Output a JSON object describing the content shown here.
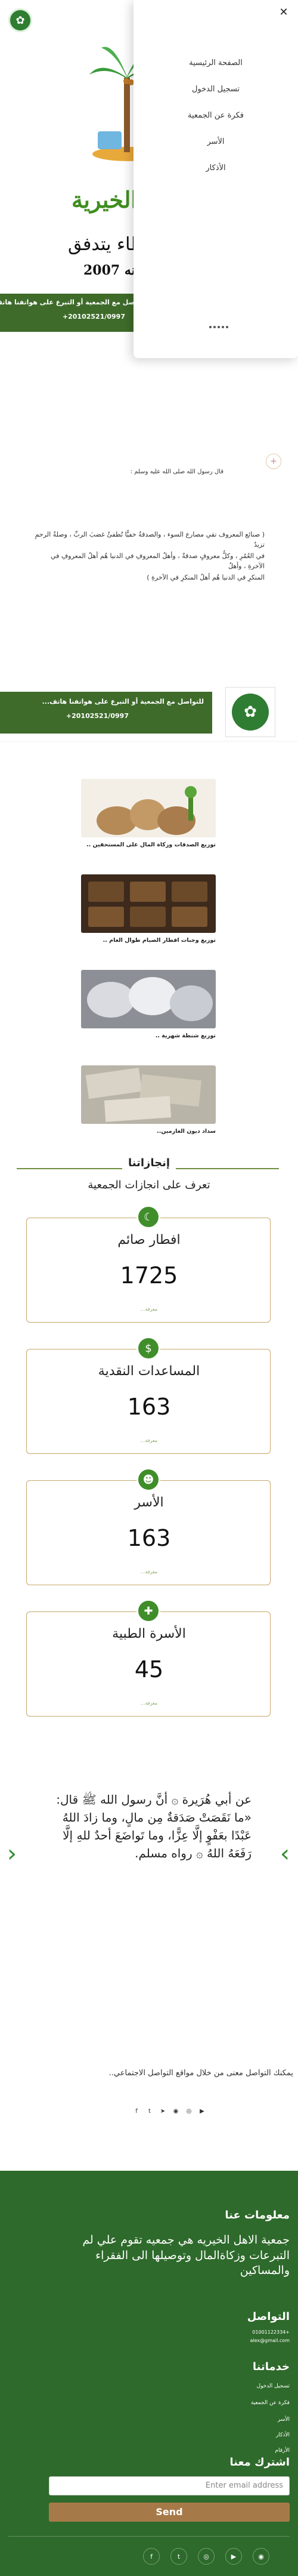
{
  "hero": {
    "name": "الخيرية",
    "line1": "عطاء يتدفق",
    "line2": "بسنه 2007",
    "bar_text": "للتواصل مع الجمعية أو التبرع على هواتفنا هاتف...",
    "bar_phone": "20102521/0997+"
  },
  "menu": {
    "items": [
      "الصفحة الرئيسية",
      "تسجيل الدخول",
      "فكرة عن الجمعية",
      "الأسر",
      "الأذكار"
    ],
    "close_icon": "close-icon"
  },
  "intro": {
    "hadith_ref": "قال رسول الله صلى الله عليه وسلم :",
    "p1": "( صنائع المعروف تقي مصارع السوء ، والصدقةُ خفيًّا تُطفئُ غضبَ الربِّ ، وصلةُ الرحمِ تزيدُ",
    "p2": "في العُمُرِ ، وكلُّ معروفٍ صدقةٌ ، وأهلُ المعروفِ في الدنيا هُم أهلُ المعروفِ في الآخرةِ ، وأهلُ",
    "p3": "المنكرِ في الدنيا هُم أهلُ المنكرِ في الآخرةِ )"
  },
  "section2": {
    "bar_text": "للتواصل مع الجمعية أو التبرع على هواتفنا هاتف...",
    "bar_phone": "20102521/0997+"
  },
  "gallery": [
    {
      "caption": "توزيع الصدقات وزكاة المال على المستحقين .."
    },
    {
      "caption": "توزيع وجبات افطار الصيام طوال العام .."
    },
    {
      "caption": "توزيع شنطة شهرية .."
    },
    {
      "caption": "سداد ديون الغارمين.."
    }
  ],
  "achievements": {
    "title": "إنجازاتنا",
    "subtitle": "تعرف على انجازات الجمعية",
    "cards": [
      {
        "label": "افطار صائم",
        "value": "1725",
        "more": "معرفة..."
      },
      {
        "label": "المساعدات النقدية",
        "value": "163",
        "more": "معرفة..."
      },
      {
        "label": "الأسر",
        "value": "163",
        "more": "معرفة..."
      },
      {
        "label": "الأسرة الطبية",
        "value": "45",
        "more": "معرفة..."
      }
    ]
  },
  "hadith": {
    "text": "عن أبي هُرَيرة ۞ أنَّ رسول الله ﷺ قال: «ما نَقَصَتْ صَدَقةٌ مِن مالٍ، وما زادَ اللهُ عَبْدًا بعَفْوٍ إلَّا عِزًّا، وما تَواضَعَ أحدٌ للهِ إلَّا رَفَعَهُ اللهُ ۞ رواه مسلم."
  },
  "social": {
    "text": "يمكنك التواصل معنى من خلال مواقع التواصل الاجتماعي..",
    "icons": [
      "facebook-icon",
      "twitter-icon",
      "telegram-icon",
      "github-icon",
      "instagram-icon",
      "youtube-icon"
    ]
  },
  "footer": {
    "about_title": "معلومات عنا",
    "about_text": "جمعية الاهل الخيريه هي جمعيه تقوم علي لم التبرعات وزكاةالمال وتوصيلها الى الفقراء والمساكين",
    "contact_title": "التواصل",
    "contact_phone": "+01001122334",
    "contact_email": "alex@gmail.com",
    "services_title": "خدماتنا",
    "services": [
      "تسجيل الدخول",
      "فكرة عن الجمعية",
      "الأسر",
      "الأذكار",
      "الأرقام"
    ],
    "subscribe_title": "اشترك معنا",
    "email_placeholder": "Enter email address",
    "send_label": "Send",
    "social_icons": [
      "facebook-icon",
      "twitter-icon",
      "instagram-icon",
      "youtube-icon",
      "github-icon"
    ]
  },
  "colors": {
    "brand_green": "#3e6b2a",
    "footer_green": "#2e6a2b",
    "accent_gold": "#c7a76b",
    "send_brown": "#a67a48"
  }
}
